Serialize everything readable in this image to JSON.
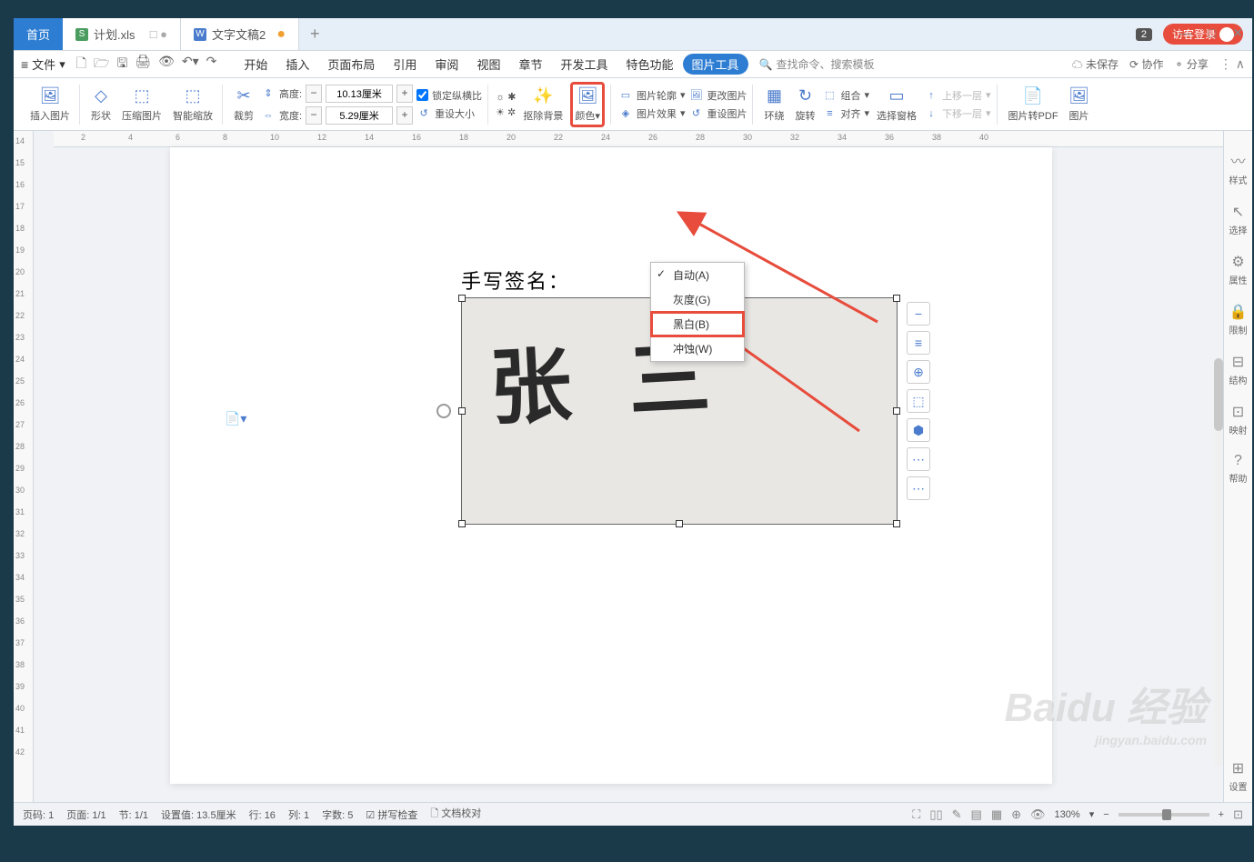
{
  "tabs": {
    "home": "首页",
    "file1": "计划.xls",
    "file2": "文字文稿2"
  },
  "window": {
    "min": "—",
    "max": "□",
    "close": "✕"
  },
  "titlebar_right": {
    "badge": "2",
    "login": "访客登录"
  },
  "menubar": {
    "file": "文件",
    "items": [
      "开始",
      "插入",
      "页面布局",
      "引用",
      "审阅",
      "视图",
      "章节",
      "开发工具",
      "特色功能"
    ],
    "active": "图片工具",
    "search": "查找命令、搜索模板",
    "unsaved": "未保存",
    "collab": "协作",
    "share": "分享"
  },
  "ribbon": {
    "insert_pic": "插入图片",
    "shape": "形状",
    "compress": "压缩图片",
    "smart_scale": "智能缩放",
    "crop": "裁剪",
    "height_label": "高度:",
    "height_value": "10.13厘米",
    "width_label": "宽度:",
    "width_value": "5.29厘米",
    "lock_ratio": "锁定纵横比",
    "reset_size": "重设大小",
    "remove_bg": "抠除背景",
    "color": "颜色",
    "outline": "图片轮廓",
    "change_pic": "更改图片",
    "effects": "图片效果",
    "reset_pic": "重设图片",
    "wrap": "环绕",
    "rotate": "旋转",
    "group": "组合",
    "align": "对齐",
    "select_pane": "选择窗格",
    "move_up": "上移一层",
    "move_down": "下移一层",
    "to_pdf": "图片转PDF",
    "pic_more": "图片"
  },
  "dropdown": {
    "auto": "自动(A)",
    "gray": "灰度(G)",
    "bw": "黑白(B)",
    "wash": "冲蚀(W)"
  },
  "document": {
    "label": "手写签名：",
    "signature": "张 三"
  },
  "side_panel": [
    "样式",
    "选择",
    "属性",
    "限制",
    "结构",
    "映射",
    "帮助",
    "设置"
  ],
  "statusbar": {
    "page_no": "页码: 1",
    "pages": "页面: 1/1",
    "section": "节: 1/1",
    "set_value": "设置值: 13.5厘米",
    "row": "行: 16",
    "col": "列: 1",
    "chars": "字数: 5",
    "spellcheck": "拼写检查",
    "doc_proof": "文档校对",
    "zoom": "130%"
  },
  "watermark": {
    "brand": "Baidu 经验",
    "url": "jingyan.baidu.com"
  },
  "float_tools": [
    "−",
    "≡",
    "⊕",
    "⬚",
    "⬢",
    "⋯",
    "⋯"
  ]
}
